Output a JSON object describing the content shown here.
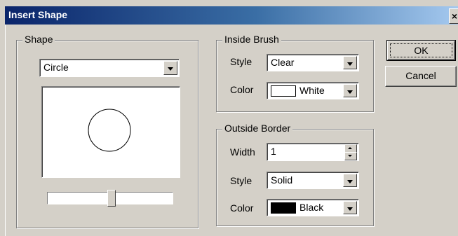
{
  "window": {
    "title": "Insert Shape",
    "close_glyph": "×"
  },
  "shape_group": {
    "legend": "Shape",
    "shape_select": {
      "value": "Circle"
    },
    "preview": {
      "shape": "circle"
    },
    "size_slider": {
      "position": 0.51
    }
  },
  "inside_brush": {
    "legend": "Inside Brush",
    "style_label": "Style",
    "style_value": "Clear",
    "color_label": "Color",
    "color_value": "White",
    "color_swatch": "#ffffff"
  },
  "outside_border": {
    "legend": "Outside Border",
    "width_label": "Width",
    "width_value": "1",
    "style_label": "Style",
    "style_value": "Solid",
    "color_label": "Color",
    "color_value": "Black",
    "color_swatch": "#000000"
  },
  "buttons": {
    "ok": "OK",
    "cancel": "Cancel"
  },
  "colors": {
    "titlebar_start": "#0a246a",
    "titlebar_end": "#a6caf0",
    "dialog_bg": "#d4d0c8"
  }
}
